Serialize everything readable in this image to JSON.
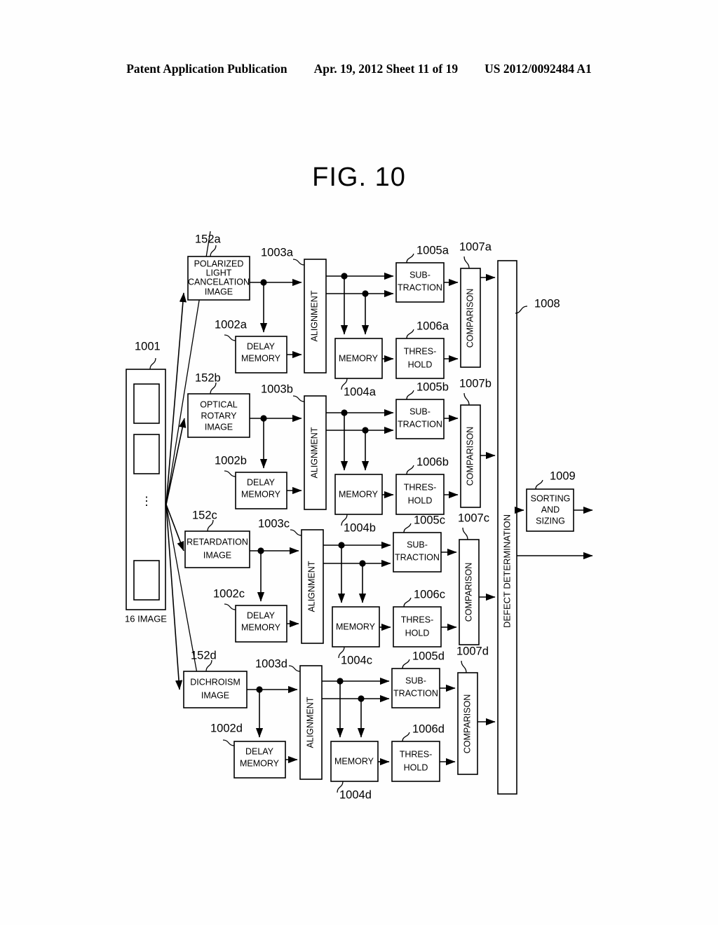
{
  "header": {
    "publication": "Patent Application Publication",
    "date_sheet": "Apr. 19, 2012  Sheet 11 of 19",
    "doc_number": "US 2012/0092484 A1"
  },
  "figure": {
    "title": "FIG. 10"
  },
  "source": {
    "ref": "1001",
    "caption": "16 IMAGE",
    "dots": "⋮"
  },
  "channels": [
    {
      "id": "a",
      "image_ref": "152a",
      "image_label": "POLARIZED\nLIGHT\nCANCELATION\nIMAGE",
      "image_lines": [
        "POLARIZED",
        "LIGHT",
        "CANCELATION",
        "IMAGE"
      ],
      "delay_ref": "1002a",
      "delay_lines": [
        "DELAY",
        "MEMORY"
      ],
      "alignment_ref": "1003a",
      "alignment_label": "ALIGNMENT",
      "memory_ref": "1004a",
      "memory_label": "MEMORY",
      "subtraction_ref": "1005a",
      "subtraction_lines": [
        "SUB-",
        "TRACTION"
      ],
      "threshold_ref": "1006a",
      "threshold_lines": [
        "THRES-",
        "HOLD"
      ],
      "comparison_ref": "1007a",
      "comparison_label": "COMPARISON"
    },
    {
      "id": "b",
      "image_ref": "152b",
      "image_label": "OPTICAL\nROTARY\nIMAGE",
      "image_lines": [
        "OPTICAL",
        "ROTARY",
        "IMAGE"
      ],
      "delay_ref": "1002b",
      "delay_lines": [
        "DELAY",
        "MEMORY"
      ],
      "alignment_ref": "1003b",
      "alignment_label": "ALIGNMENT",
      "memory_ref": "1004b",
      "memory_label": "MEMORY",
      "subtraction_ref": "1005b",
      "subtraction_lines": [
        "SUB-",
        "TRACTION"
      ],
      "threshold_ref": "1006b",
      "threshold_lines": [
        "THRES-",
        "HOLD"
      ],
      "comparison_ref": "1007b",
      "comparison_label": "COMPARISON"
    },
    {
      "id": "c",
      "image_ref": "152c",
      "image_label": "RETARDATION\nIMAGE",
      "image_lines": [
        "RETARDATION",
        "IMAGE"
      ],
      "delay_ref": "1002c",
      "delay_lines": [
        "DELAY",
        "MEMORY"
      ],
      "alignment_ref": "1003c",
      "alignment_label": "ALIGNMENT",
      "memory_ref": "1004c",
      "memory_label": "MEMORY",
      "subtraction_ref": "1005c",
      "subtraction_lines": [
        "SUB-",
        "TRACTION"
      ],
      "threshold_ref": "1006c",
      "threshold_lines": [
        "THRES-",
        "HOLD"
      ],
      "comparison_ref": "1007c",
      "comparison_label": "COMPARISON"
    },
    {
      "id": "d",
      "image_ref": "152d",
      "image_label": "DICHROISM\nIMAGE",
      "image_lines": [
        "DICHROISM",
        "IMAGE"
      ],
      "delay_ref": "1002d",
      "delay_lines": [
        "DELAY",
        "MEMORY"
      ],
      "alignment_ref": "1003d",
      "alignment_label": "ALIGNMENT",
      "memory_ref": "1004d",
      "memory_label": "MEMORY",
      "subtraction_ref": "1005d",
      "subtraction_lines": [
        "SUB-",
        "TRACTION"
      ],
      "threshold_ref": "1006d",
      "threshold_lines": [
        "THRES-",
        "HOLD"
      ],
      "comparison_ref": "1007d",
      "comparison_label": "COMPARISON"
    }
  ],
  "defect_determination": {
    "ref": "1008",
    "label": "DEFECT DETERMINATION"
  },
  "sorting": {
    "ref": "1009",
    "lines": [
      "SORTING",
      "AND",
      "SIZING"
    ]
  },
  "colors": {
    "ink": "#000000",
    "paper": "#ffffff"
  }
}
